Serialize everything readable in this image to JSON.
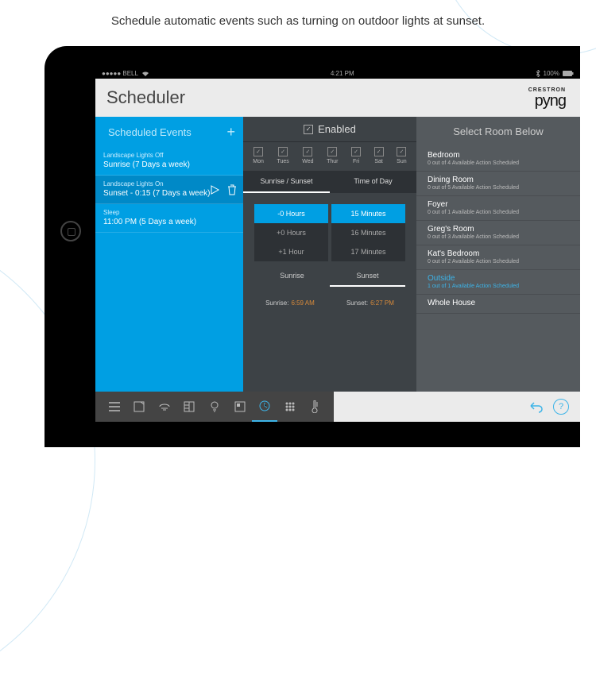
{
  "marketing_text": "Schedule automatic events such as turning on outdoor lights at sunset.",
  "status_bar": {
    "carrier": "●●●●● BELL",
    "wifi": "⚸",
    "time": "4:21 PM",
    "bt": "⚹",
    "battery_pct": "100%",
    "battery_icon": "▮"
  },
  "app": {
    "title": "Scheduler",
    "brand_top": "CRESTRON",
    "brand_main": "pyng"
  },
  "events_panel": {
    "title": "Scheduled Events",
    "items": [
      {
        "name": "Landscape Lights Off",
        "detail": "Sunrise  (7 Days a week)"
      },
      {
        "name": "Landscape Lights On",
        "detail": "Sunset - 0:15 (7 Days a week)",
        "selected": true
      },
      {
        "name": "Sleep",
        "detail": "11:00 PM (5 Days a week)"
      }
    ]
  },
  "time_panel": {
    "enabled_label": "Enabled",
    "days": [
      "Mon",
      "Tues",
      "Wed",
      "Thur",
      "Fri",
      "Sat",
      "Sun"
    ],
    "tabs": {
      "left": "Sunrise / Sunset",
      "right": "Time of Day"
    },
    "picker": {
      "hours": [
        "-0 Hours",
        "+0 Hours",
        "+1 Hour"
      ],
      "minutes": [
        "15 Minutes",
        "16 Minutes",
        "17 Minutes"
      ]
    },
    "sun_tabs": {
      "left": "Sunrise",
      "right": "Sunset"
    },
    "sunrise": {
      "label": "Sunrise:",
      "value": "6:59 AM"
    },
    "sunset": {
      "label": "Sunset:",
      "value": "6:27 PM"
    }
  },
  "rooms_panel": {
    "title": "Select Room Below",
    "items": [
      {
        "name": "Bedroom",
        "detail": "0 out of 4 Available Action Scheduled"
      },
      {
        "name": "Dining Room",
        "detail": "0 out of 5 Available Action Scheduled"
      },
      {
        "name": "Foyer",
        "detail": "0 out of 1 Available Action Scheduled"
      },
      {
        "name": "Greg's Room",
        "detail": "0 out of 3 Available Action Scheduled"
      },
      {
        "name": "Kat's Bedroom",
        "detail": "0 out of 2 Available Action Scheduled"
      },
      {
        "name": "Outside",
        "detail": "1 out of 1 Available Action Scheduled",
        "highlight": true
      },
      {
        "name": "Whole House",
        "detail": ""
      }
    ]
  },
  "bottom_icons": {
    "menu": "≡",
    "undo": "↶",
    "help": "?"
  }
}
